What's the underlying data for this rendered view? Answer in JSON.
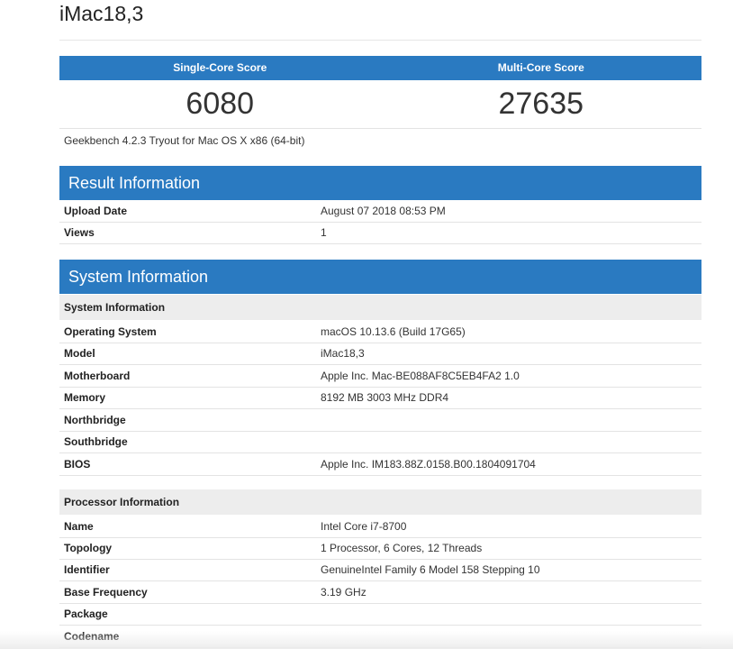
{
  "device_title": "iMac18,3",
  "scores": {
    "single_label": "Single-Core Score",
    "multi_label": "Multi-Core Score",
    "single_value": "6080",
    "multi_value": "27635"
  },
  "version": "Geekbench 4.2.3 Tryout for Mac OS X x86 (64-bit)",
  "result_information": {
    "title": "Result Information",
    "rows": [
      {
        "key": "Upload Date",
        "value": "August 07 2018 08:53 PM"
      },
      {
        "key": "Views",
        "value": "1"
      }
    ]
  },
  "system_information": {
    "title": "System Information",
    "system_sub": {
      "title": "System Information",
      "rows": [
        {
          "key": "Operating System",
          "value": "macOS 10.13.6 (Build 17G65)"
        },
        {
          "key": "Model",
          "value": "iMac18,3"
        },
        {
          "key": "Motherboard",
          "value": "Apple Inc. Mac-BE088AF8C5EB4FA2 1.0"
        },
        {
          "key": "Memory",
          "value": "8192 MB 3003 MHz DDR4"
        },
        {
          "key": "Northbridge",
          "value": ""
        },
        {
          "key": "Southbridge",
          "value": ""
        },
        {
          "key": "BIOS",
          "value": "Apple Inc. IM183.88Z.0158.B00.1804091704"
        }
      ]
    },
    "processor_sub": {
      "title": "Processor Information",
      "rows": [
        {
          "key": "Name",
          "value": "Intel Core i7-8700"
        },
        {
          "key": "Topology",
          "value": "1 Processor, 6 Cores, 12 Threads"
        },
        {
          "key": "Identifier",
          "value": "GenuineIntel Family 6 Model 158 Stepping 10"
        },
        {
          "key": "Base Frequency",
          "value": "3.19 GHz"
        },
        {
          "key": "Package",
          "value": ""
        },
        {
          "key": "Codename",
          "value": ""
        }
      ]
    }
  },
  "colors": {
    "header_blue": "#2a7ac1",
    "subhead_gray": "#ededed"
  }
}
